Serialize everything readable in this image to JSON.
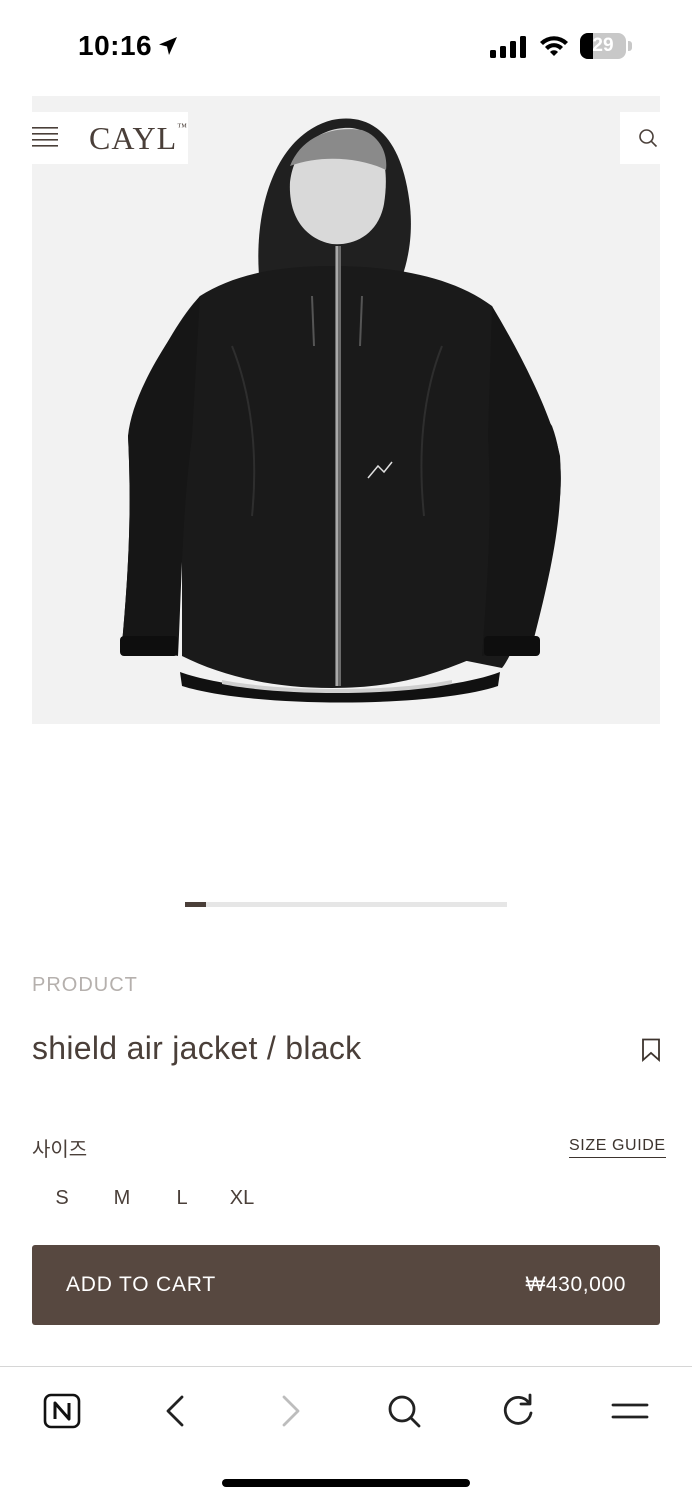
{
  "status_bar": {
    "time": "10:16",
    "battery_level": "29",
    "battery_fraction": 0.29
  },
  "header": {
    "brand": "CAYL",
    "brand_mark": "™",
    "icons": [
      "menu-icon",
      "search-icon"
    ]
  },
  "gallery": {
    "image_alt": "shield air jacket black",
    "active_index": 1,
    "slide_fraction": 0.0667
  },
  "product": {
    "section_label": "PRODUCT",
    "title": "shield air jacket / black",
    "size_label": "사이즈",
    "size_guide_label": "SIZE GUIDE",
    "sizes": [
      "S",
      "M",
      "L",
      "XL"
    ],
    "add_to_cart_label": "ADD TO CART",
    "price": "₩430,000"
  },
  "colors": {
    "brand_brown": "#574840",
    "text_brown": "#4a3f39",
    "muted": "#b5b0ad"
  },
  "browser_toolbar": {
    "icons": [
      "naver-home-icon",
      "back-arrow-icon",
      "forward-arrow-icon",
      "search-icon",
      "reload-icon",
      "menu-icon"
    ],
    "forward_enabled": false
  }
}
